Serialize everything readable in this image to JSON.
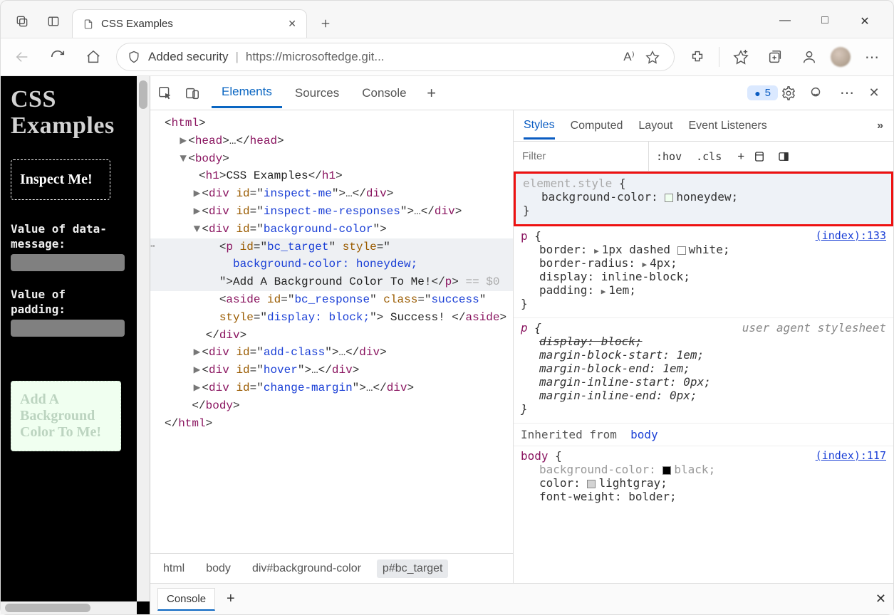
{
  "browser": {
    "tab": {
      "title": "CSS Examples"
    },
    "addressbar": {
      "security_label": "Added security",
      "url": "https://microsoftedge.git..."
    }
  },
  "page": {
    "heading": "CSS Examples",
    "inspect_box": "Inspect Me!",
    "label_data_message_a": "Value of ",
    "label_data_message_b": "data-message:",
    "label_padding_a": "Value of ",
    "label_padding_b": "padding:",
    "bgcolor_box": "Add A Background Color To Me!"
  },
  "devtools": {
    "tabs": {
      "elements": "Elements",
      "sources": "Sources",
      "console": "Console"
    },
    "issues_count": "5",
    "dom": {
      "html_open": "<html>",
      "head": "<head>…</head>",
      "body_open": "<body>",
      "h1": "CSS Examples",
      "div_inspect": "<div id=\"inspect-me\">…</div>",
      "div_responses": "<div id=\"inspect-me-responses\">…</div>",
      "div_bg_open": "<div id=\"background-color\">",
      "p_open_a": "<p id=\"bc_target\" style=\"",
      "p_open_b": "background-color: honeydew;",
      "p_text": "Add A Background Color To Me!",
      "p_tail": " == $0",
      "aside_a": "<aside id=\"bc_response\" class=\"success\"",
      "aside_b": "style=\"display: block;\">",
      "aside_txt": " Success! ",
      "aside_close": "</aside>",
      "div_close": "</div>",
      "div_addclass": "<div id=\"add-class\">…</div>",
      "div_hover": "<div id=\"hover\">…</div>",
      "div_margin": "<div id=\"change-margin\">…</div>",
      "body_close": "</body>",
      "html_close": "</html>"
    },
    "crumbs": {
      "c1": "html",
      "c2": "body",
      "c3": "div#background-color",
      "c4": "p#bc_target"
    },
    "styles": {
      "tabs": {
        "styles": "Styles",
        "computed": "Computed",
        "layout": "Layout",
        "events": "Event Listeners"
      },
      "filter_placeholder": "Filter",
      "hov": ":hov",
      "cls": ".cls",
      "rule1": {
        "sel": "element.style",
        "prop": "background-color",
        "val": "honeydew"
      },
      "rule2": {
        "sel": "p",
        "src": "(index):133",
        "border_name": "border",
        "border_val": "1px dashed",
        "border_color": "white",
        "radius_name": "border-radius",
        "radius_val": "4px",
        "display_name": "display",
        "display_val": "inline-block",
        "padding_name": "padding",
        "padding_val": "1em"
      },
      "rule3": {
        "sel": "p",
        "ua": "user agent stylesheet",
        "l1n": "display",
        "l1v": "block",
        "l2n": "margin-block-start",
        "l2v": "1em",
        "l3n": "margin-block-end",
        "l3v": "1em",
        "l4n": "margin-inline-start",
        "l4v": "0px",
        "l5n": "margin-inline-end",
        "l5v": "0px"
      },
      "inherited_label": "Inherited from",
      "inherited_from": "body",
      "rule4": {
        "sel": "body",
        "src": "(index):117",
        "bg_name": "background-color",
        "bg_val": "black",
        "color_name": "color",
        "color_val": "lightgray",
        "fw_name": "font-weight",
        "fw_val": "bolder"
      }
    },
    "drawer": {
      "console": "Console"
    }
  }
}
